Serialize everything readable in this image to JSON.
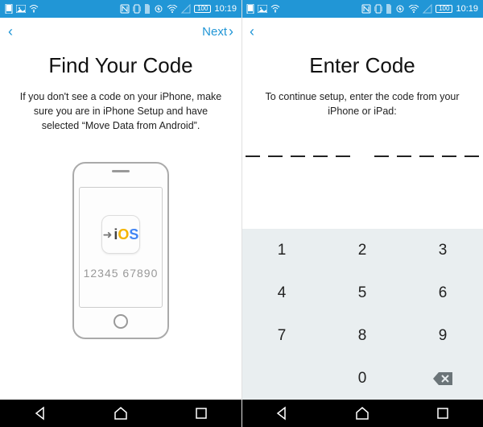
{
  "status": {
    "time": "10:19",
    "battery": "100"
  },
  "left": {
    "next": "Next",
    "title": "Find Your Code",
    "desc": "If you don't see a code on your iPhone, make sure you are in iPhone Setup and have selected “Move Data from Android”.",
    "ios_label": "iOS",
    "sample_code": "12345 67890"
  },
  "right": {
    "title": "Enter Code",
    "desc": "To continue setup, enter the code from your iPhone or iPad:",
    "keys": {
      "k1": "1",
      "k2": "2",
      "k3": "3",
      "k4": "4",
      "k5": "5",
      "k6": "6",
      "k7": "7",
      "k8": "8",
      "k9": "9",
      "k0": "0"
    }
  }
}
